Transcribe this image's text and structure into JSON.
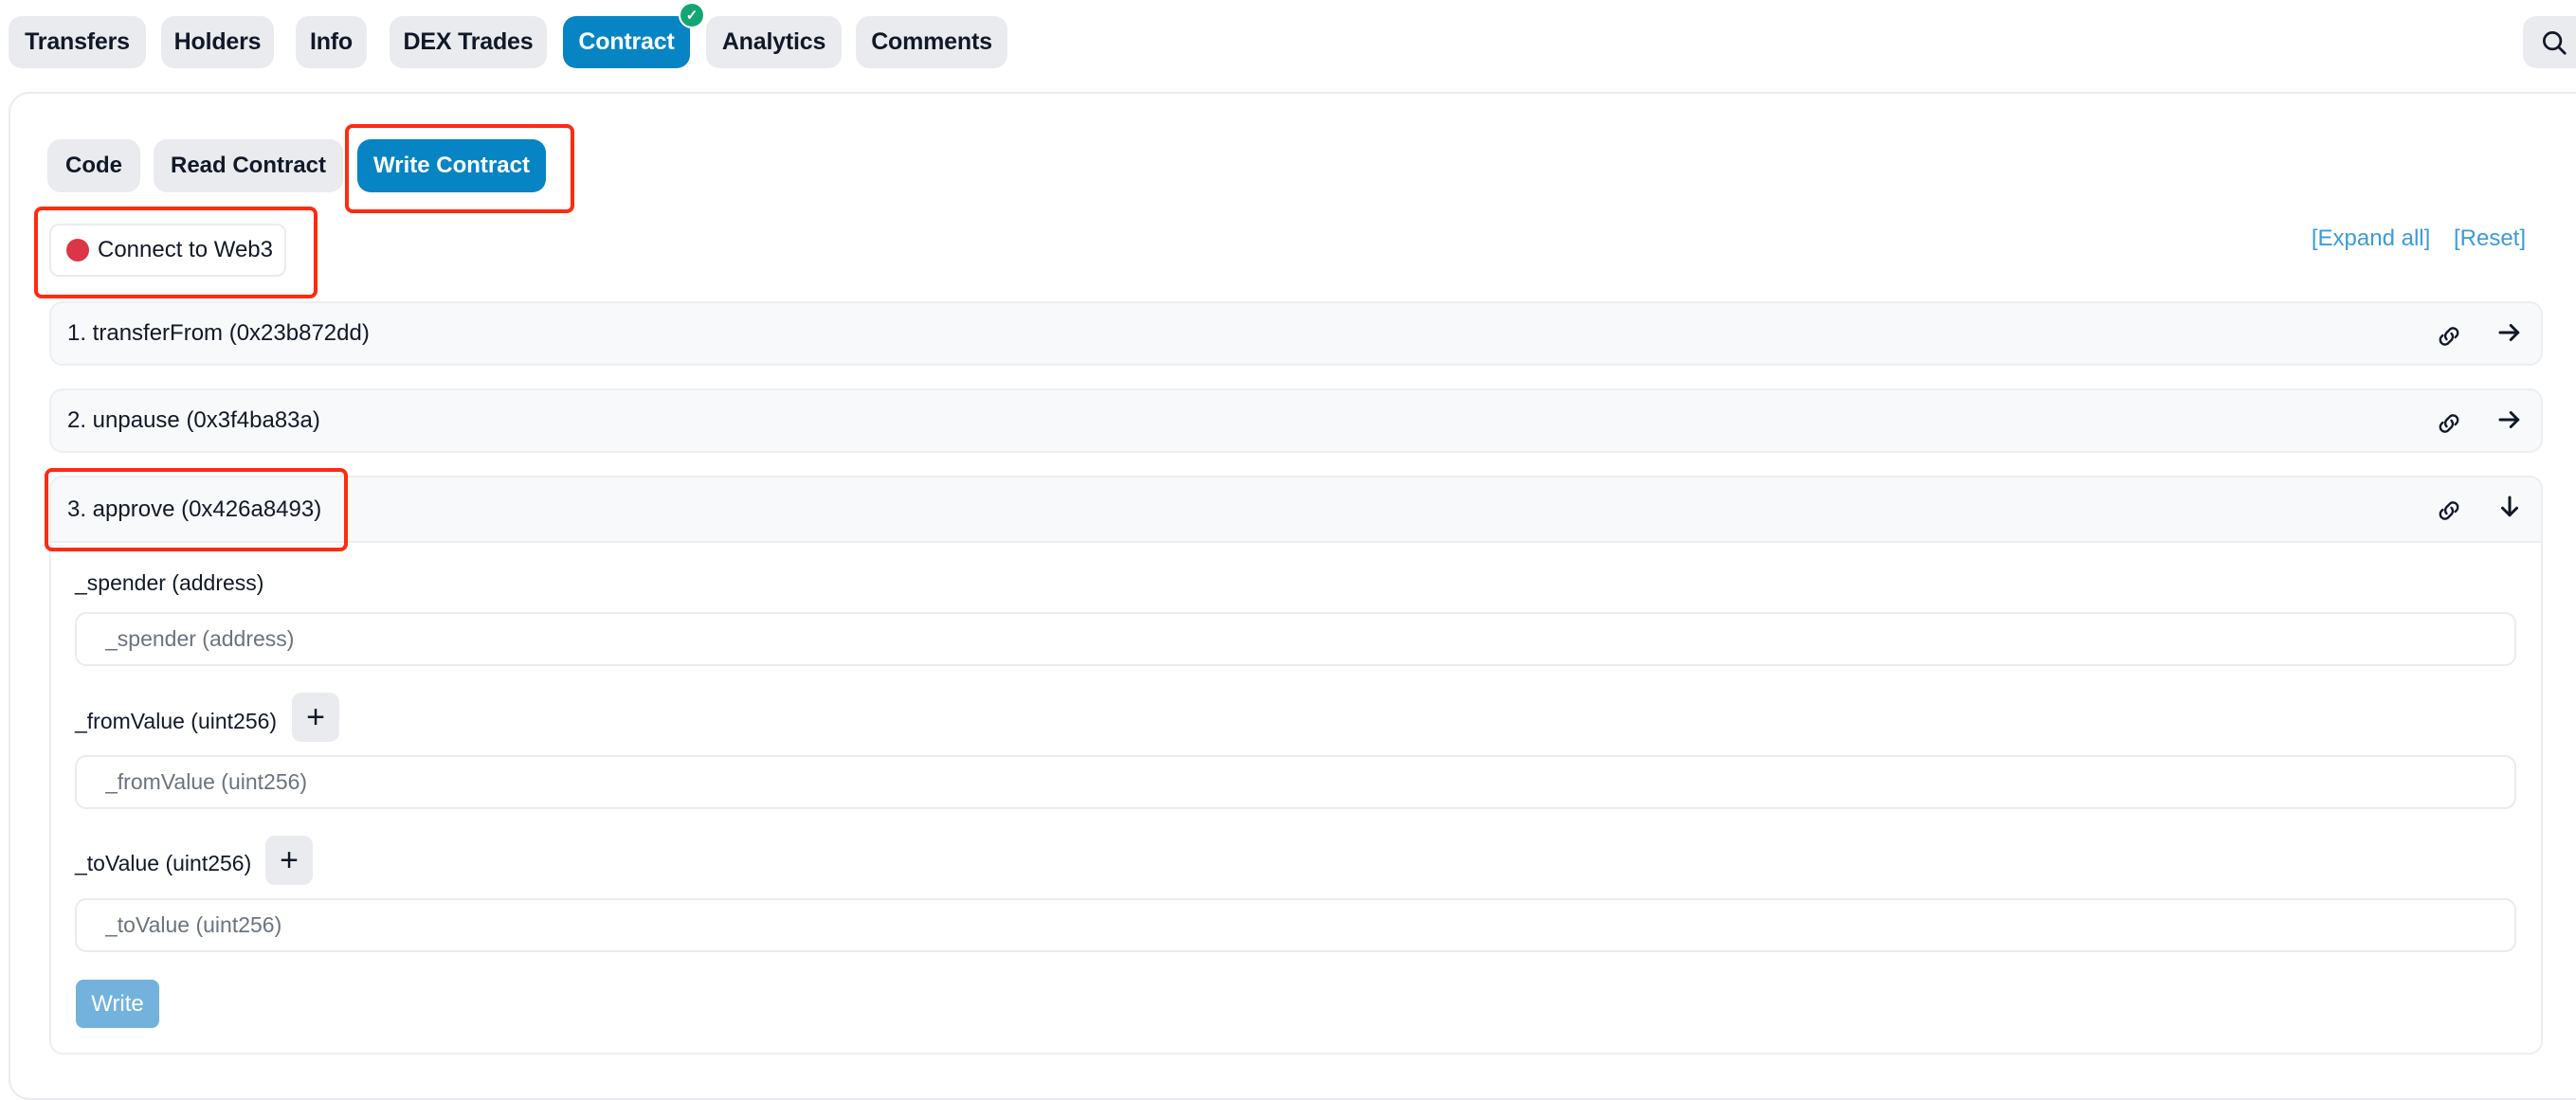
{
  "tabs": [
    {
      "label": "Transfers",
      "active": false
    },
    {
      "label": "Holders",
      "active": false
    },
    {
      "label": "Info",
      "active": false
    },
    {
      "label": "DEX Trades",
      "active": false
    },
    {
      "label": "Contract",
      "active": true,
      "verified": true
    },
    {
      "label": "Analytics",
      "active": false
    },
    {
      "label": "Comments",
      "active": false
    }
  ],
  "search": {
    "icon": "search-icon"
  },
  "subtabs": [
    {
      "label": "Code",
      "active": false
    },
    {
      "label": "Read Contract",
      "active": false
    },
    {
      "label": "Write Contract",
      "active": true
    }
  ],
  "connect": {
    "label": "Connect to Web3",
    "status_color": "#dc3545",
    "status": "disconnected"
  },
  "actions": {
    "expand_all": "[Expand all]",
    "reset": "[Reset]"
  },
  "functions": [
    {
      "title": "1. transferFrom (0x23b872dd)",
      "expanded": false
    },
    {
      "title": "2. unpause (0x3f4ba83a)",
      "expanded": false
    },
    {
      "title": "3. approve (0x426a8493)",
      "expanded": true
    }
  ],
  "approve": {
    "fields": [
      {
        "label": "_spender (address)",
        "placeholder": "_spender (address)",
        "value": "",
        "has_plus": false
      },
      {
        "label": "_fromValue (uint256)",
        "placeholder": "_fromValue (uint256)",
        "value": "",
        "has_plus": true
      },
      {
        "label": "_toValue (uint256)",
        "placeholder": "_toValue (uint256)",
        "value": "",
        "has_plus": true
      }
    ],
    "plus_label": "+",
    "write_label": "Write"
  },
  "colors": {
    "accent": "#0784c3",
    "link": "#3b9bd8",
    "verified_badge": "#13a672",
    "highlight": "#ff2a10",
    "write_disabled": "#73b2dc"
  }
}
